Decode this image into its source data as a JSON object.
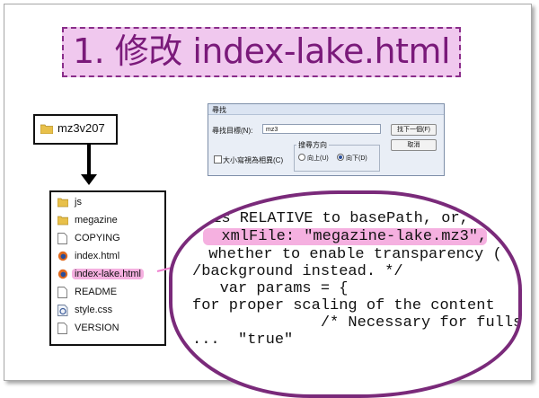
{
  "title": "1. 修改 index-lake.html",
  "folder": {
    "name": "mz3v207",
    "icon": "folder-icon"
  },
  "files": [
    {
      "name": "js",
      "icon": "folder-icon"
    },
    {
      "name": "megazine",
      "icon": "folder-icon"
    },
    {
      "name": "COPYING",
      "icon": "file-icon"
    },
    {
      "name": "index.html",
      "icon": "firefox-icon"
    },
    {
      "name": "index-lake.html",
      "icon": "firefox-icon",
      "highlighted": true
    },
    {
      "name": "README",
      "icon": "file-icon"
    },
    {
      "name": "style.css",
      "icon": "css-file-icon"
    },
    {
      "name": "VERSION",
      "icon": "file-icon"
    }
  ],
  "find_dialog": {
    "title": "尋找",
    "find_what_label": "尋找目標(N):",
    "find_what_value": "mz3",
    "find_next_button": "找下一個(F)",
    "cancel_button": "取消",
    "direction_label": "搜尋方向",
    "up_label": "向上(U)",
    "down_label": "向下(D)",
    "direction_selected": "down",
    "match_case_label": "大小寫視為相異(C)",
    "match_case_checked": false
  },
  "code_lines": [
    " is RELATIVE to basePath, or, if",
    "  xmlFile: \"megazine-lake.mz3\",",
    " whether to enable transparency (",
    "/background instead. */",
    "   var params = {",
    "for proper scaling of the content",
    "              /* Necessary for fulls",
    "...  \"true\""
  ],
  "highlight_color": "#f5b0e0",
  "accent_color": "#7a2a7a"
}
